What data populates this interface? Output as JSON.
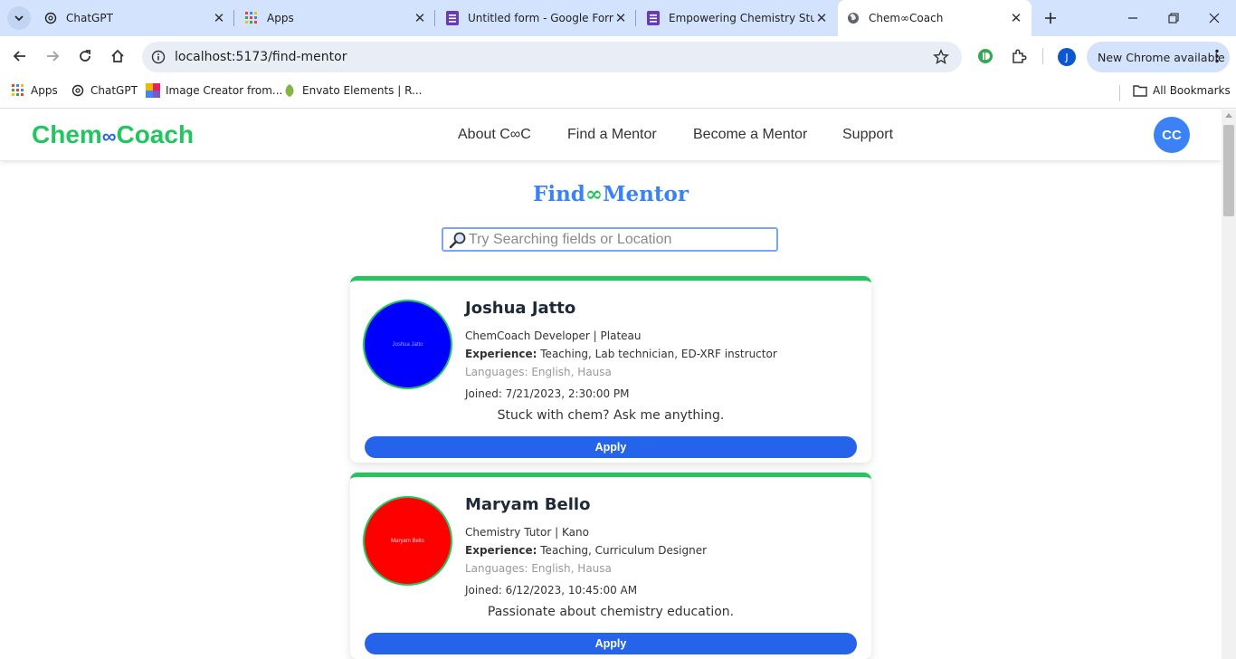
{
  "browser": {
    "tabs": [
      {
        "title": "ChatGPT",
        "icon": "chatgpt-icon"
      },
      {
        "title": "Apps",
        "icon": "apps-grid-icon"
      },
      {
        "title": "Untitled form - Google Forms",
        "icon": "google-forms-icon"
      },
      {
        "title": "Empowering Chemistry Students",
        "icon": "google-forms-icon"
      },
      {
        "title": "Chem∞Coach",
        "icon": "globe-icon",
        "active": true
      }
    ],
    "url": "localhost:5173/find-mentor",
    "profile_initial": "J",
    "update_label": "New Chrome available",
    "bookmarks": [
      {
        "label": "Apps",
        "icon": "apps-grid-icon"
      },
      {
        "label": "ChatGPT",
        "icon": "chatgpt-icon"
      },
      {
        "label": "Image Creator from...",
        "icon": "image-creator-icon"
      },
      {
        "label": "Envato Elements | R...",
        "icon": "envato-leaf-icon"
      }
    ],
    "all_bookmarks_label": "All Bookmarks"
  },
  "site": {
    "logo_left": "Chem",
    "logo_infinity": "∞",
    "logo_right": "Coach",
    "nav": [
      "About C∞C",
      "Find a Mentor",
      "Become a Mentor",
      "Support"
    ],
    "user_initials": "CC"
  },
  "find": {
    "title_left": "Find",
    "title_infinity": "∞",
    "title_right": "Mentor",
    "search_placeholder": "Try Searching fields or Location",
    "apply_label": "Apply",
    "mentors": [
      {
        "name": "Joshua Jatto",
        "avatar_color": "#0000ff",
        "avatar_text_color": "#9aa0ff",
        "role_location": "ChemCoach Developer | Plateau",
        "experience_label": "Experience:",
        "experience": "Teaching, Lab technician, ED-XRF instructor",
        "languages": "Languages: English, Hausa",
        "joined": "Joined: 7/21/2023, 2:30:00 PM",
        "bio": "Stuck with chem? Ask me anything."
      },
      {
        "name": "Maryam Bello",
        "avatar_color": "#ff0000",
        "avatar_text_color": "#ffd6d6",
        "role_location": "Chemistry Tutor | Kano",
        "experience_label": "Experience:",
        "experience": "Teaching, Curriculum Designer",
        "languages": "Languages: English, Hausa",
        "joined": "Joined: 6/12/2023, 10:45:00 AM",
        "bio": "Passionate about chemistry education."
      }
    ]
  },
  "colors": {
    "brand_green": "#22c55e",
    "brand_blue": "#2563eb"
  }
}
